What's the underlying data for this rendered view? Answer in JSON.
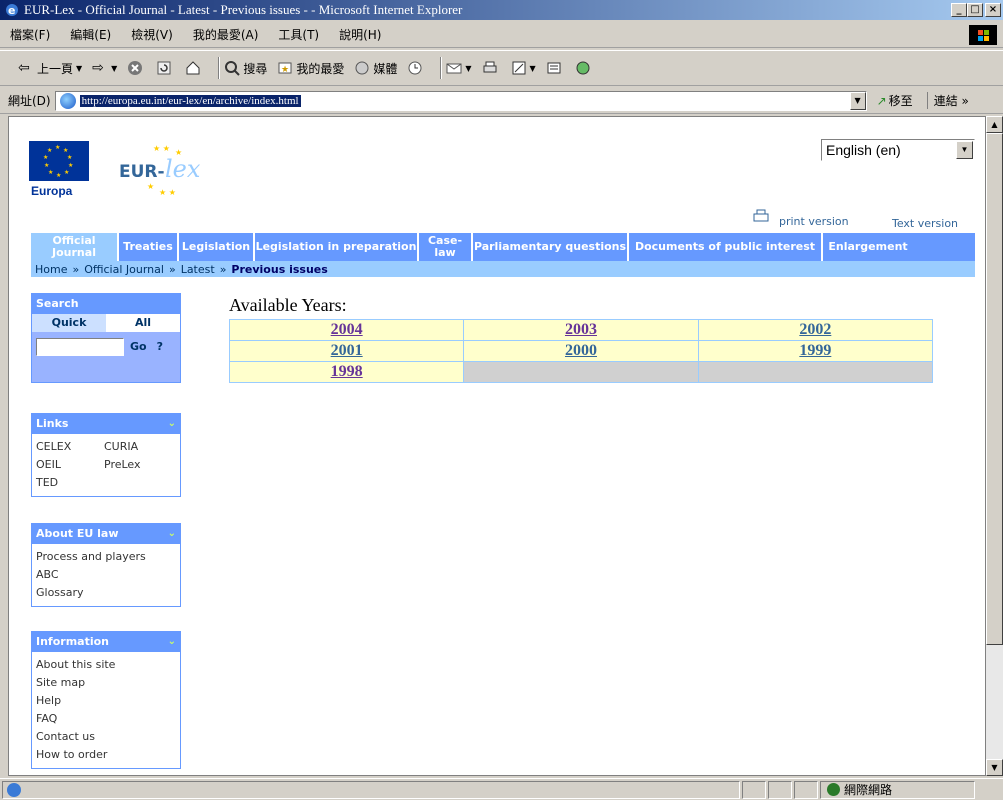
{
  "window": {
    "title": "EUR-Lex - Official Journal - Latest - Previous issues - - Microsoft Internet Explorer"
  },
  "menu": [
    "檔案(F)",
    "編輯(E)",
    "檢視(V)",
    "我的最愛(A)",
    "工具(T)",
    "說明(H)"
  ],
  "toolbar": {
    "back": "上一頁",
    "search": "搜尋",
    "favorites": "我的最愛",
    "media": "媒體"
  },
  "address": {
    "label": "網址(D)",
    "url": "http://europa.eu.int/eur-lex/en/archive/index.html",
    "go": "移至",
    "links": "連結"
  },
  "status": {
    "zone": "網際網路"
  },
  "page": {
    "europa": "Europa",
    "language": "English (en)",
    "print_version": "print version",
    "text_version": "Text version",
    "nav": [
      {
        "label": "Official Journal",
        "active": true
      },
      {
        "label": "Treaties",
        "active": false
      },
      {
        "label": "Legislation",
        "active": false
      },
      {
        "label": "Legislation in preparation",
        "active": false
      },
      {
        "label": "Case-law",
        "active": false
      },
      {
        "label": "Parliamentary questions",
        "active": false
      },
      {
        "label": "Documents of public interest",
        "active": false
      },
      {
        "label": "Enlargement",
        "active": false
      }
    ],
    "breadcrumb": {
      "home": "Home",
      "oj": "Official Journal",
      "latest": "Latest",
      "current": "Previous issues",
      "sep": "»"
    },
    "search": {
      "title": "Search",
      "tab_quick": "Quick",
      "tab_all": "All",
      "go": "Go",
      "help": "?"
    },
    "links_box": {
      "title": "Links",
      "items": [
        "CELEX",
        "CURIA",
        "OEIL",
        "PreLex",
        "TED"
      ]
    },
    "about_box": {
      "title": "About EU law",
      "items": [
        "Process and players",
        "ABC",
        "Glossary"
      ]
    },
    "info_box": {
      "title": "Information",
      "items": [
        "About this site",
        "Site map",
        "Help",
        "FAQ",
        "Contact us",
        "How to order"
      ]
    },
    "available_title": "Available Years:",
    "years": [
      [
        "2004",
        "2003",
        "2002"
      ],
      [
        "2001",
        "2000",
        "1999"
      ],
      [
        "1998",
        "",
        ""
      ]
    ]
  }
}
